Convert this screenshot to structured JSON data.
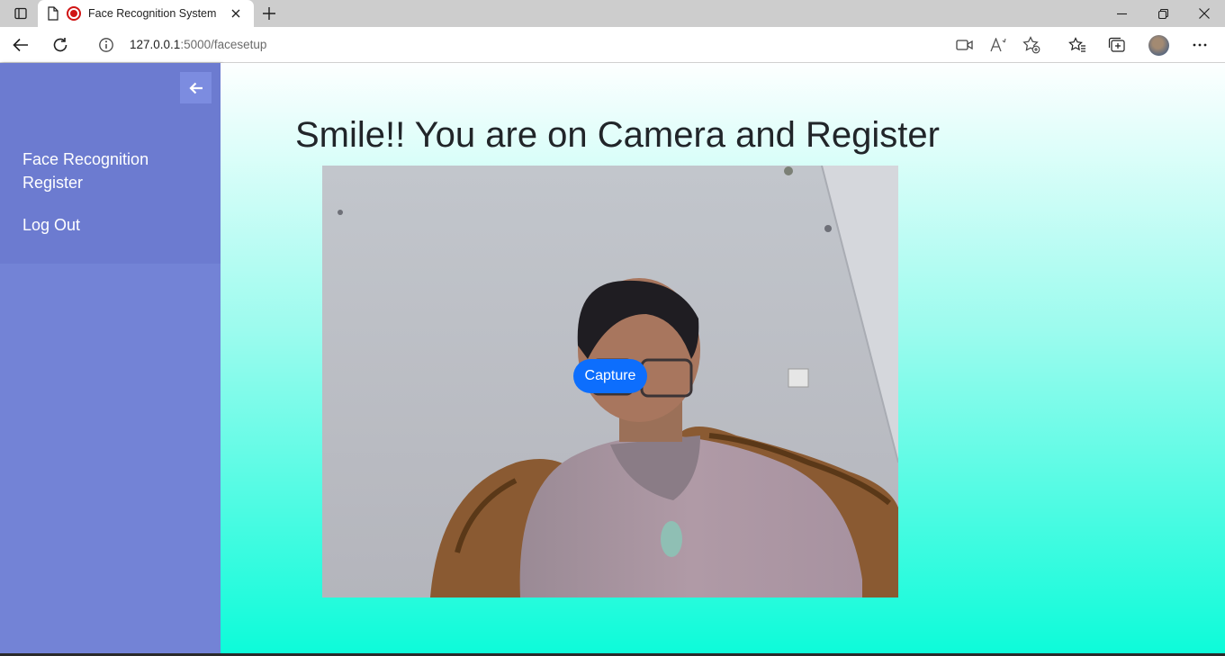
{
  "browser": {
    "tab_title": "Face Recognition System",
    "url_host": "127.0.0.1",
    "url_path": ":5000/facesetup"
  },
  "sidebar": {
    "items": [
      {
        "label": "Face Recognition Register"
      },
      {
        "label": "Log Out"
      }
    ]
  },
  "main": {
    "title": "Smile!! You are on Camera and Register",
    "capture_label": "Capture"
  },
  "colors": {
    "sidebar": "#7383d6",
    "sidebar_header": "#6c7bd0",
    "capture_button": "#0d6efd",
    "gradient_bottom": "#0cfbd9"
  }
}
